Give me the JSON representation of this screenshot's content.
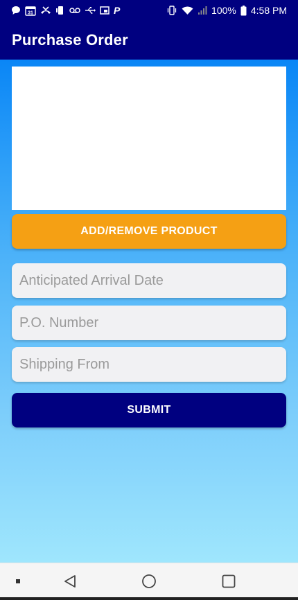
{
  "status_bar": {
    "battery_percent": "100%",
    "time": "4:58 PM",
    "left_icons": [
      "chat-icon",
      "calendar-icon",
      "missed-call-icon",
      "phone-vibrate-icon",
      "voicemail-icon",
      "usb-icon",
      "cast-icon",
      "p-app-icon"
    ],
    "right_icons": [
      "vibrate-icon",
      "wifi-icon",
      "signal-icon",
      "battery-icon"
    ],
    "calendar_day": "31",
    "p_app_letter": "P"
  },
  "app_bar": {
    "title": "Purchase Order",
    "color": "#000080"
  },
  "form": {
    "add_remove_label": "ADD/REMOVE PRODUCT",
    "arrival_date_placeholder": "Anticipated Arrival Date",
    "po_number_placeholder": "P.O. Number",
    "shipping_from_placeholder": "Shipping From",
    "submit_label": "SUBMIT"
  },
  "colors": {
    "navy": "#000080",
    "orange_button": "#f5a014",
    "gradient_top": "#0a86f6",
    "gradient_bottom": "#9fe6fd",
    "field_bg": "#f1f1f3"
  },
  "nav_bar": {
    "items": [
      "dot-icon",
      "back-icon",
      "home-icon",
      "recents-icon"
    ]
  }
}
